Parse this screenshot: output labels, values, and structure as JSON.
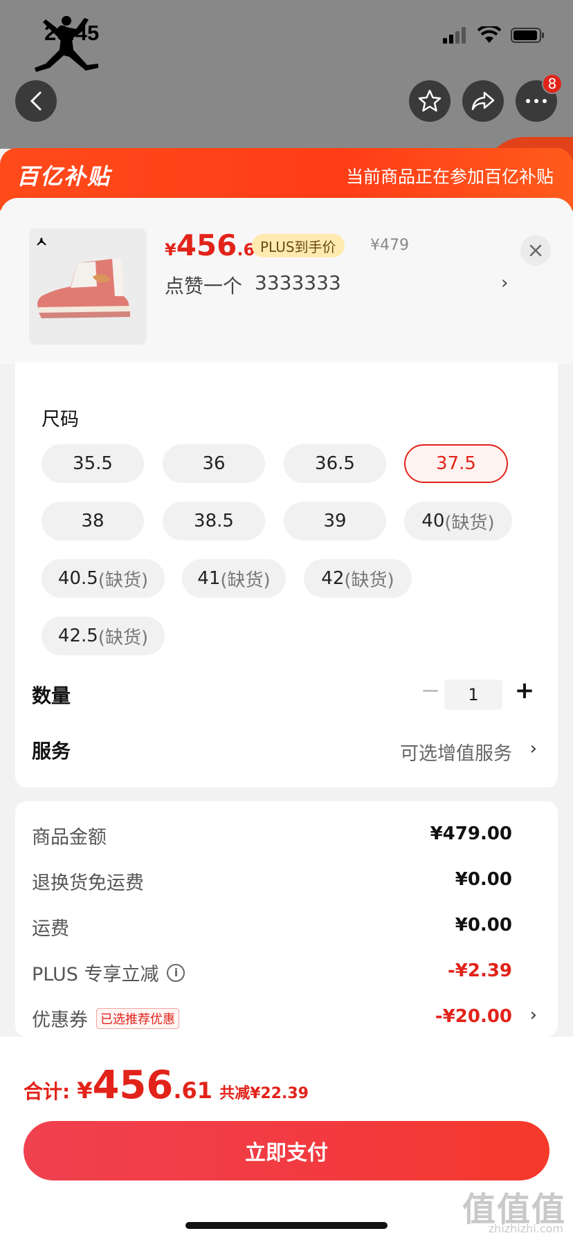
{
  "status_bar": {
    "time": "20:45"
  },
  "nav": {
    "more_badge": "8"
  },
  "banner": {
    "logo_text": "百亿补贴",
    "note": "当前商品正在参加百亿补贴"
  },
  "product": {
    "price_currency": "¥",
    "price_int": "456",
    "price_dec": ".61",
    "plus_tag": "PLUS到手价",
    "original_price": "¥479",
    "selected_label": "点赞一个",
    "selected_value": "3333333"
  },
  "sizes": {
    "label": "尺码",
    "items": [
      {
        "size": "35.5",
        "oos": ""
      },
      {
        "size": "36",
        "oos": ""
      },
      {
        "size": "36.5",
        "oos": ""
      },
      {
        "size": "37.5",
        "oos": "",
        "selected": true
      },
      {
        "size": "38",
        "oos": ""
      },
      {
        "size": "38.5",
        "oos": ""
      },
      {
        "size": "39",
        "oos": ""
      },
      {
        "size": "40",
        "oos": "(缺货)"
      },
      {
        "size": "40.5",
        "oos": "(缺货)"
      },
      {
        "size": "41",
        "oos": "(缺货)"
      },
      {
        "size": "42",
        "oos": "(缺货)"
      },
      {
        "size": "42.5",
        "oos": "(缺货)"
      }
    ]
  },
  "quantity": {
    "label": "数量",
    "value": "1",
    "minus": "−",
    "plus": "+"
  },
  "service": {
    "label": "服务",
    "value": "可选增值服务"
  },
  "costs": {
    "items": [
      {
        "label": "商品金额",
        "value": "¥479.00"
      },
      {
        "label": "退换货免运费",
        "value": "¥0.00"
      },
      {
        "label": "运费",
        "value": "¥0.00"
      },
      {
        "label": "PLUS 专享立减",
        "value": "-¥2.39"
      },
      {
        "label": "优惠券",
        "tag": "已选推荐优惠",
        "value": "-¥20.00"
      }
    ]
  },
  "total": {
    "label": "合计:",
    "currency": "¥",
    "int": "456",
    "dec": ".61",
    "saved": "共减¥22.39"
  },
  "pay_button": {
    "label": "立即支付"
  },
  "watermark": {
    "text": "值值值",
    "url": "zhizhizhi.com"
  },
  "colors": {
    "accent": "#e2231a",
    "banner": "#ff4a1a",
    "pay_button": "#f23a3f",
    "plus_tag_bg": "#ffeab0"
  }
}
